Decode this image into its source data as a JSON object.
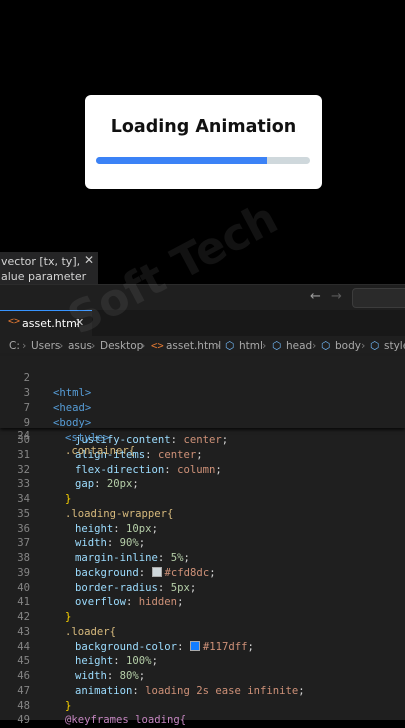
{
  "preview": {
    "title": "Loading Animation",
    "progress_fraction": 0.8,
    "bar_color": "#3b82f6",
    "track_color": "#cfd8dc"
  },
  "tooltip": {
    "line1": "vector [tx, ty],",
    "line2": "alue parameter",
    "close": "✕"
  },
  "titlebar": {
    "back": "←",
    "forward": "→"
  },
  "tab": {
    "icon": "<>",
    "label": "asset.html",
    "close": "✕"
  },
  "breadcrumb": {
    "items": [
      "C:",
      "Users",
      "asus",
      "Desktop",
      "asset.html",
      "html",
      "head",
      "body",
      "style"
    ]
  },
  "sticky_lines": [
    {
      "n": "2",
      "text": "<html>"
    },
    {
      "n": "3",
      "text": "<head>"
    },
    {
      "n": "7",
      "text": "<body>"
    },
    {
      "n": "9",
      "text": "<style>"
    },
    {
      "n": "24",
      "text": ".container{"
    }
  ],
  "code_lines": [
    {
      "n": "30",
      "prop": "justify-content",
      "val": "center"
    },
    {
      "n": "31",
      "prop": "align-items",
      "val": "center"
    },
    {
      "n": "32",
      "prop": "flex-direction",
      "val": "column"
    },
    {
      "n": "33",
      "prop": "gap",
      "val": "20px"
    },
    {
      "n": "34",
      "text": "}"
    },
    {
      "n": "35",
      "text": ".loading-wrapper{"
    },
    {
      "n": "36",
      "prop": "height",
      "val": "10px"
    },
    {
      "n": "37",
      "prop": "width",
      "val": "90%"
    },
    {
      "n": "38",
      "prop": "margin-inline",
      "val": "5%"
    },
    {
      "n": "39",
      "prop": "background",
      "val": "#cfd8dc",
      "swatch": "#cfd8dc"
    },
    {
      "n": "40",
      "prop": "border-radius",
      "val": "5px"
    },
    {
      "n": "41",
      "prop": "overflow",
      "val": "hidden"
    },
    {
      "n": "42",
      "text": "}"
    },
    {
      "n": "43",
      "text": ".loader{"
    },
    {
      "n": "44",
      "prop": "background-color",
      "val": "#117dff",
      "swatch": "#117dff"
    },
    {
      "n": "45",
      "prop": "height",
      "val": "100%"
    },
    {
      "n": "46",
      "prop": "width",
      "val": "80%"
    },
    {
      "n": "47",
      "prop": "animation",
      "val": "loading 2s ease infinite"
    },
    {
      "n": "48",
      "text": "}"
    },
    {
      "n": "49",
      "text": "@keyframes loading{"
    }
  ],
  "watermark": "Soft Tech"
}
